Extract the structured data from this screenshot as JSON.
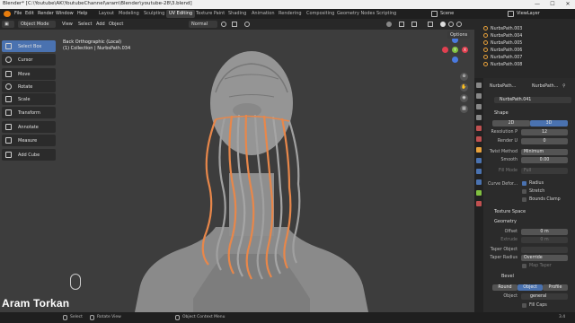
{
  "window": {
    "title": "Blender* [C:\\Youtube\\AK\\YoutubeChannel\\aram\\Blender\\youtube-28\\3.blend]",
    "minimize": "—",
    "maximize": "☐",
    "close": "✕"
  },
  "menubar": {
    "menus": [
      "File",
      "Edit",
      "Render",
      "Window",
      "Help"
    ],
    "workspaces": [
      "Layout",
      "Modeling",
      "Sculpting",
      "UV Editing",
      "Texture Paint",
      "Shading",
      "Animation",
      "Rendering",
      "Compositing",
      "Geometry Nodes",
      "Scripting"
    ],
    "active_workspace": "UV Editing",
    "scene": "Scene",
    "view_layer": "ViewLayer"
  },
  "header": {
    "mode": "Object Mode",
    "view": "View",
    "select": "Select",
    "add": "Add",
    "object": "Object",
    "orientation": "Normal",
    "options": "Options"
  },
  "toolbar": {
    "items": [
      "Select Box",
      "Cursor",
      "Move",
      "Rotate",
      "Scale",
      "Transform",
      "Annotate",
      "Measure",
      "Add Cube"
    ],
    "active": "Select Box"
  },
  "viewport": {
    "view_name": "Back Orthographic (Local)",
    "collection": "(1) Collection | NurbsPath.034"
  },
  "gizmo": {
    "x_label": "X",
    "y_label": "Y",
    "z_label": "Z",
    "x_color": "#e04050",
    "y_color": "#80c040",
    "z_color": "#4a7ae0"
  },
  "outliner": {
    "items": [
      "NurbsPath.003",
      "NurbsPath.004",
      "NurbsPath.005",
      "NurbsPath.006",
      "NurbsPath.007",
      "NurbsPath.008"
    ]
  },
  "properties": {
    "breadcrumb_a": "NurbsPath...",
    "breadcrumb_b": "NurbsPath...",
    "data_name": "NurbsPath.041",
    "shape": {
      "title": "Shape",
      "mode_2d": "2D",
      "mode_3d": "3D",
      "resolution_p_label": "Resolution P",
      "resolution_p": "12",
      "render_u_label": "Render U",
      "render_u": "0",
      "twist_method_label": "Twist Method",
      "twist_method": "Minimum",
      "smooth_label": "Smooth",
      "smooth": "0.00",
      "fill_mode_label": "Fill Mode",
      "fill_mode": "Full",
      "curve_deform_label": "Curve Defor...",
      "radius_label": "Radius",
      "stretch_label": "Stretch",
      "bounds_clamp_label": "Bounds Clamp"
    },
    "texture_space": "Texture Space",
    "geometry": {
      "title": "Geometry",
      "offset_label": "Offset",
      "offset": "0 m",
      "extrude_label": "Extrude",
      "extrude": "0 m",
      "taper_object_label": "Taper Object",
      "taper_radius_label": "Taper Radius",
      "taper_radius": "Override",
      "map_taper_label": "Map Taper"
    },
    "bevel": {
      "title": "Bevel",
      "round": "Round",
      "object": "Object",
      "profile": "Profile",
      "object_label": "Object",
      "object_value": "general",
      "fill_caps_label": "Fill Caps"
    }
  },
  "statusbar": {
    "select": "Select",
    "rotate": "Rotate View",
    "context": "Object Context Menu",
    "version": "3.4"
  },
  "watermark": "Aram Torkan",
  "colors": {
    "accent": "#4a72b0",
    "hair_outline": "#e8874a",
    "viewport_bg": "#3d3d3d",
    "active_tab": "#e8a13b"
  }
}
